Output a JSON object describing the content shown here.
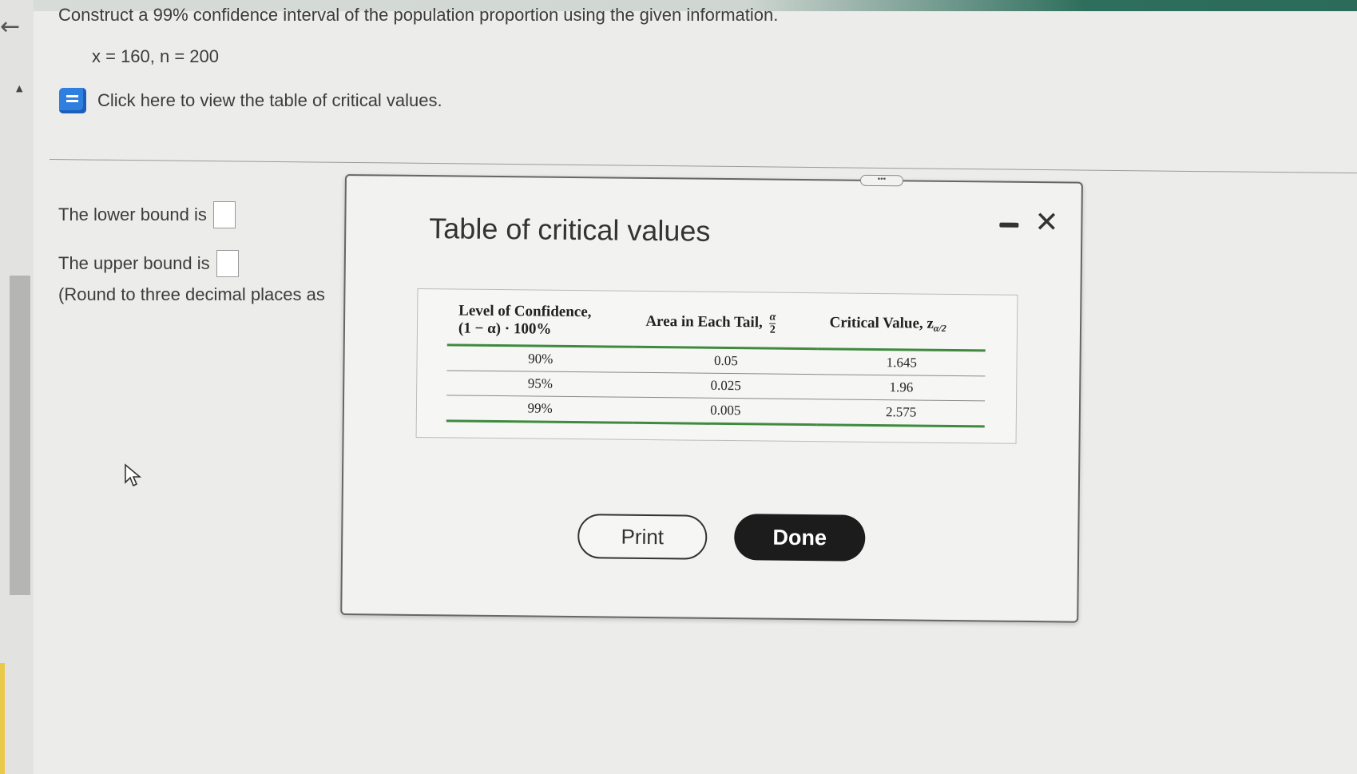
{
  "question": {
    "prompt": "Construct a 99% confidence interval of the population proportion using the given information.",
    "given": "x = 160, n = 200",
    "table_link": "Click here to view the table of critical values."
  },
  "answers": {
    "lower_label": "The lower bound is",
    "upper_label": "The upper bound is",
    "round_note": "(Round to three decimal places as"
  },
  "modal": {
    "title": "Table of critical values",
    "table": {
      "headers": {
        "confidence_line1": "Level of Confidence,",
        "confidence_line2": "(1 − α) · 100%",
        "area": "Area in Each Tail,",
        "area_frac_num": "α",
        "area_frac_den": "2",
        "critical": "Critical Value, z",
        "critical_sub": "α/2"
      },
      "rows": [
        {
          "confidence": "90%",
          "area": "0.05",
          "critical": "1.645"
        },
        {
          "confidence": "95%",
          "area": "0.025",
          "critical": "1.96"
        },
        {
          "confidence": "99%",
          "area": "0.005",
          "critical": "2.575"
        }
      ]
    },
    "print_label": "Print",
    "done_label": "Done",
    "handle_label": "•••",
    "close_symbol": "✕"
  },
  "icons": {
    "back": "back-arrow-icon",
    "book": "book-icon",
    "minimize": "minimize-icon",
    "close": "close-icon",
    "cursor": "mouse-pointer-icon"
  },
  "colors": {
    "accent_green": "#3f8a3f",
    "book_blue": "#2f7fe0",
    "done_bg": "#1c1c1c"
  }
}
